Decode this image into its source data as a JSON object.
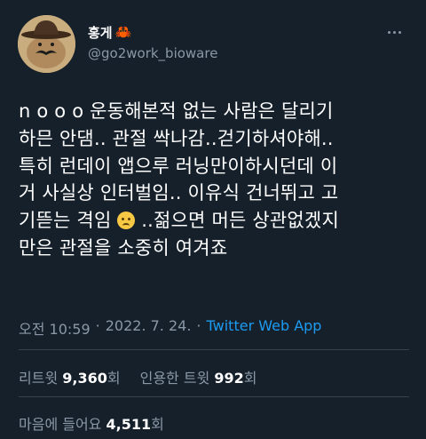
{
  "author": {
    "display_name": "홍게",
    "emoji_icon": "crab-icon",
    "handle": "@go2work_bioware"
  },
  "tweet": {
    "lines": [
      "n o o o  운동해본적 없는 사람은 달리기",
      "하믄 안댐.. 관절 싹나감..걷기하셔야해..",
      "특히 런데이 앱으루 러닝만이하시던데 이",
      "거 사실상 인터벌임.. 이유식 건너뛰고 고",
      "기뜯는 격임",
      "..젊으면 머든 상관없겠지",
      "만은 관절을 소중히 여겨죠"
    ]
  },
  "meta": {
    "time": "오전 10:59",
    "sep1": "·",
    "date": "2022. 7. 24.",
    "sep2": "·",
    "source": "Twitter Web App"
  },
  "stats": {
    "retweets_label": "리트윗",
    "retweets_count": "9,360",
    "retweets_unit": "회",
    "quotes_label": "인용한 트윗",
    "quotes_count": "992",
    "quotes_unit": "회",
    "likes_label": "마음에 들어요",
    "likes_count": "4,511",
    "likes_unit": "회"
  },
  "colors": {
    "background": "#15202b",
    "text": "#ffffff",
    "muted": "#8b98a5",
    "link": "#1d9bf0",
    "divider": "#38444d"
  }
}
